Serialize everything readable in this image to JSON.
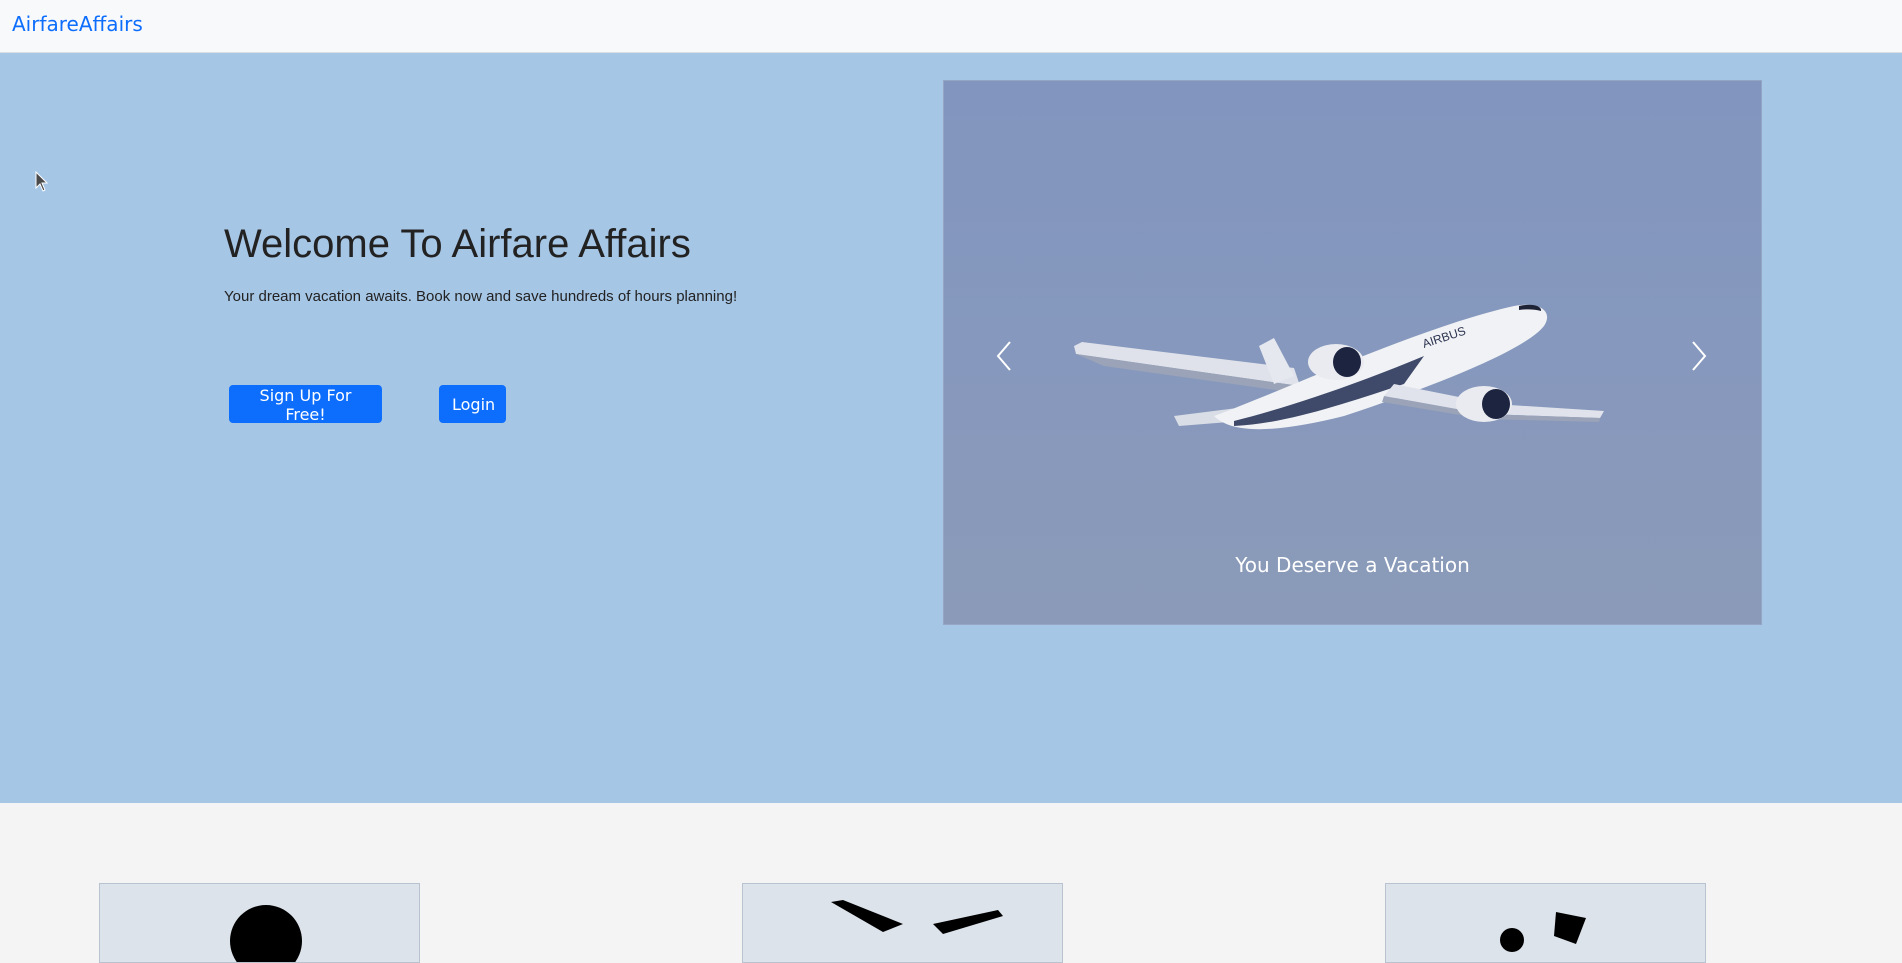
{
  "navbar": {
    "brand": "AirfareAffairs"
  },
  "hero": {
    "title": "Welcome To Airfare Affairs",
    "subtitle": "Your dream vacation awaits. Book now and save hundreds of hours planning!",
    "signup_label": "Sign Up For Free!",
    "login_label": "Login"
  },
  "carousel": {
    "caption": "You Deserve a Vacation",
    "prev_icon": "chevron-left-icon",
    "next_icon": "chevron-right-icon",
    "plane_livery": "AIRBUS"
  },
  "colors": {
    "hero_bg": "#a6c6e6",
    "accent": "#0d6efd",
    "navbar_bg": "#f8f9fa",
    "page_bg": "#f4f4f4"
  },
  "cards": [
    {
      "icon": "person-icon"
    },
    {
      "icon": "airplane-icon"
    },
    {
      "icon": "beach-icon"
    }
  ]
}
